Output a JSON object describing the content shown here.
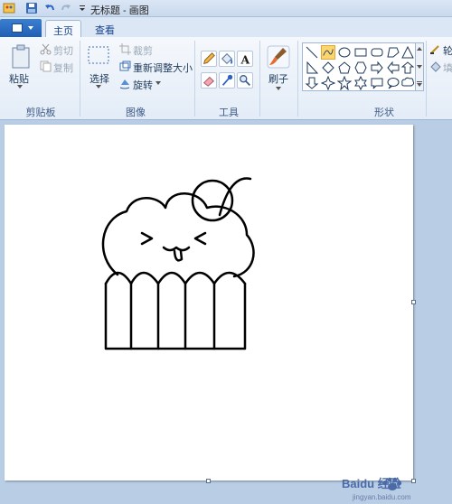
{
  "window": {
    "title": "无标题 - 画图"
  },
  "tabs": [
    {
      "label": "主页",
      "active": true
    },
    {
      "label": "查看",
      "active": false
    }
  ],
  "clipboard": {
    "paste_label": "粘贴",
    "cut_label": "剪切",
    "copy_label": "复制",
    "group_label": "剪贴板"
  },
  "image": {
    "select_label": "选择",
    "crop_label": "裁剪",
    "resize_label": "重新调整大小",
    "rotate_label": "旋转",
    "group_label": "图像"
  },
  "tools": {
    "group_label": "工具"
  },
  "brushes": {
    "label": "刷子"
  },
  "shapes": {
    "group_label": "形状",
    "outline_label": "轮",
    "fill_label": "填"
  },
  "watermark": {
    "text": "Baidu 经验",
    "subtext": "jingyan.baidu.com"
  },
  "colors": {
    "accent": "#1f5fb4",
    "ribbon_bg": "#f5f8fc",
    "workspace": "#b9cde5"
  }
}
